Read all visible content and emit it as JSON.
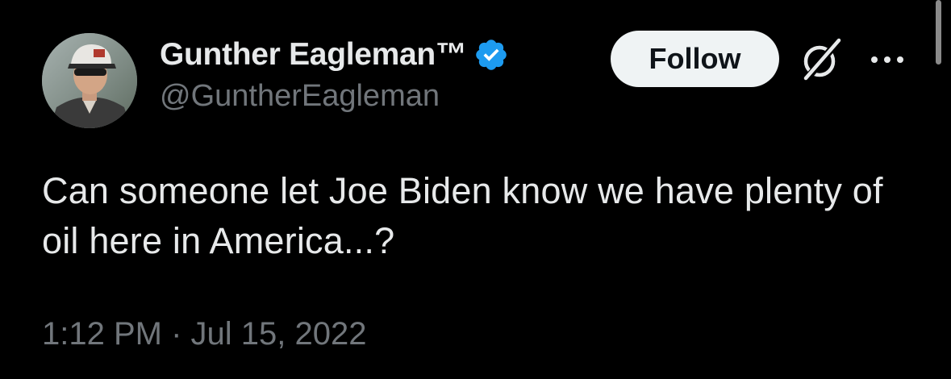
{
  "author": {
    "display_name": "Gunther Eagleman™",
    "handle": "@GuntherEagleman",
    "verified": true,
    "verified_color": "#1d9bf0"
  },
  "actions": {
    "follow_label": "Follow",
    "grok_icon": "grok-icon",
    "more_icon": "more-horizontal-icon"
  },
  "tweet": {
    "text": "Can someone let Joe Biden know we have plenty of oil here in America...?",
    "time": "1:12 PM",
    "separator": "·",
    "date": "Jul 15, 2022"
  },
  "colors": {
    "background": "#000000",
    "primary_text": "#e7e9ea",
    "secondary_text": "#71767b",
    "button_bg": "#eff3f4"
  }
}
